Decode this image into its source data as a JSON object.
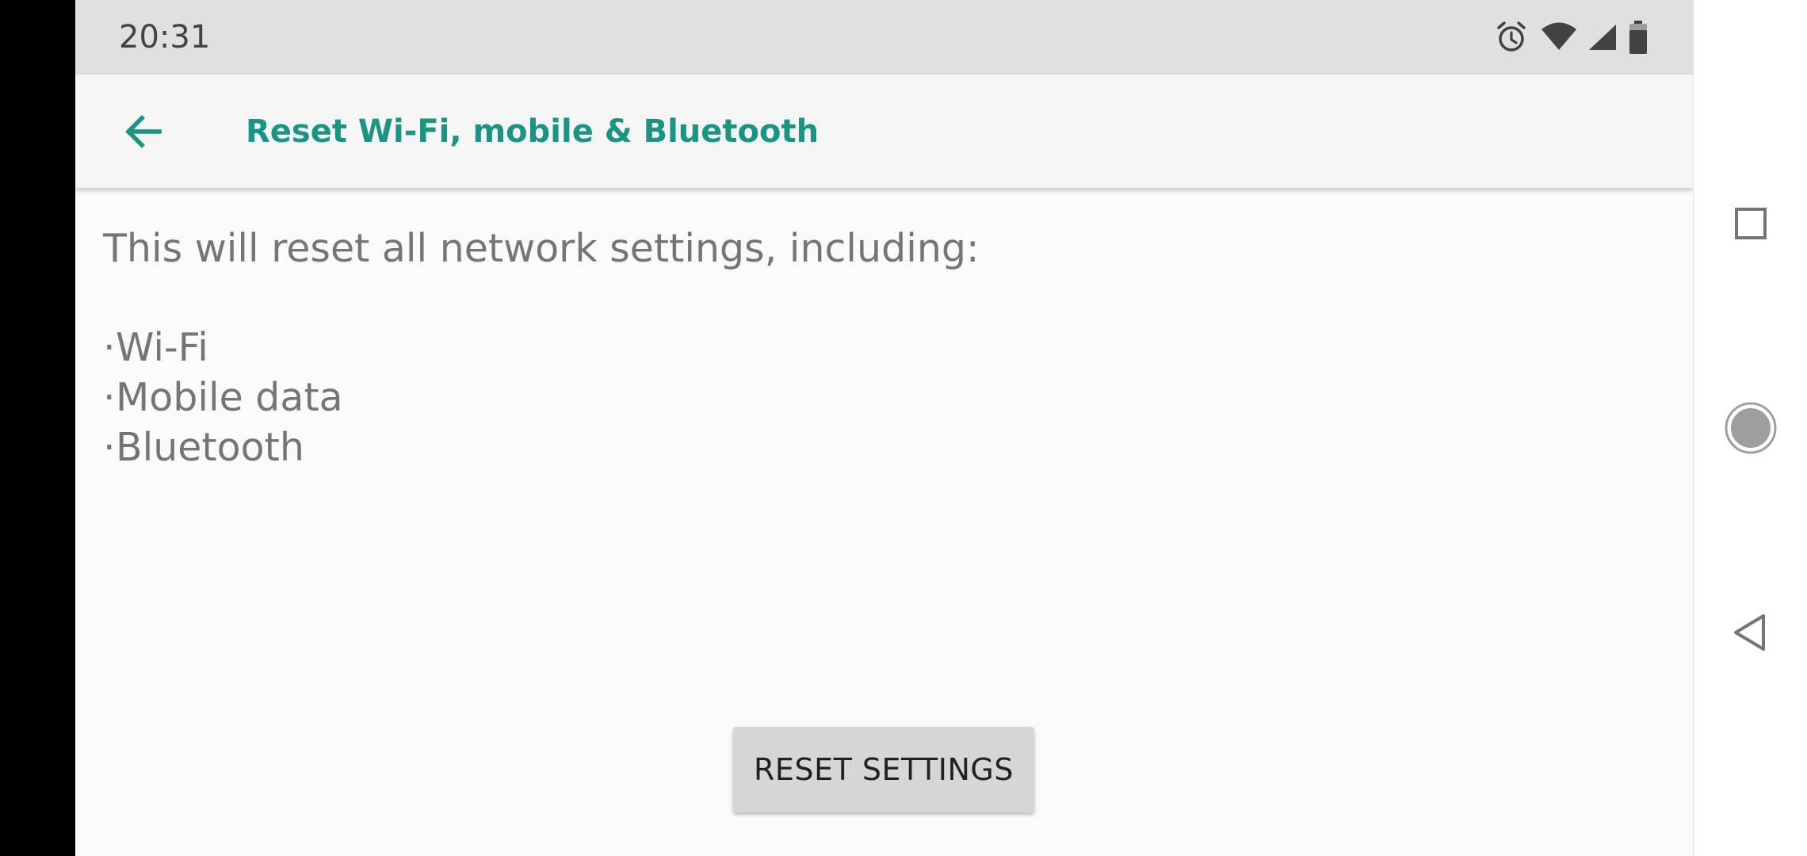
{
  "status_bar": {
    "time": "20:31",
    "icons": [
      "alarm-icon",
      "wifi-icon",
      "cellular-signal-icon",
      "battery-icon"
    ]
  },
  "app_bar": {
    "back_icon": "arrow-back-icon",
    "title": "Reset Wi-Fi, mobile & Bluetooth"
  },
  "content": {
    "intro": "This will reset all network settings, including:",
    "items": [
      "Wi-Fi",
      "Mobile data",
      "Bluetooth"
    ],
    "bullet": "·"
  },
  "reset_button": {
    "label": "RESET SETTINGS"
  },
  "nav_bar": {
    "buttons": [
      "recents-icon",
      "home-icon",
      "back-triangle-icon"
    ]
  },
  "colors": {
    "accent": "#1a9484",
    "status_bar_bg": "#e0e0e0",
    "app_bar_bg": "#f5f5f5",
    "content_bg": "#fafafa",
    "body_text": "#757575",
    "button_bg": "#d6d6d6"
  }
}
